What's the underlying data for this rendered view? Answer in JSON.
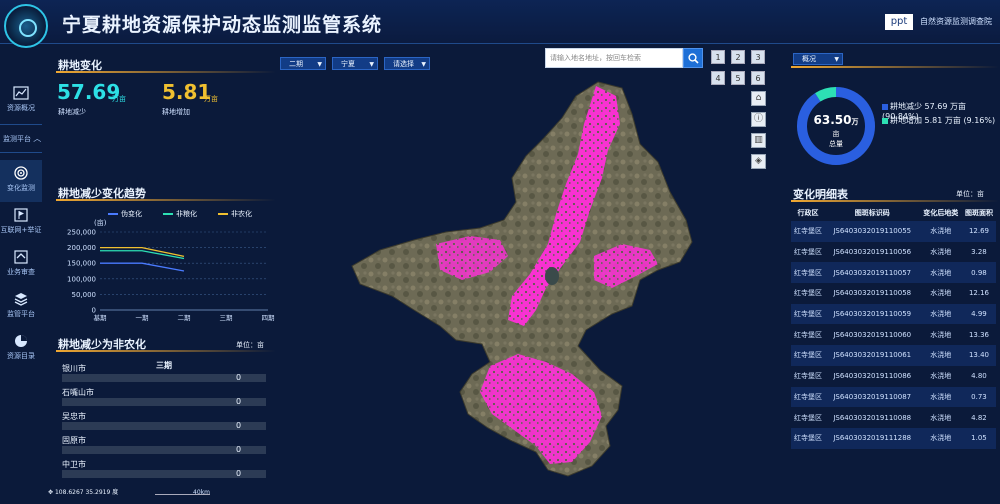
{
  "header": {
    "title": "宁夏耕地资源保护动态监测监管系统",
    "ppt_label": "ppt",
    "org": "自然资源监测调查院"
  },
  "nav": {
    "items": [
      {
        "label": "资源概况",
        "icon": "chart-line-icon"
      },
      {
        "label": "监测平台",
        "icon": "chevron-up-icon"
      },
      {
        "label": "变化监测",
        "icon": "target-icon"
      },
      {
        "label": "互联网+举证",
        "icon": "flag-icon"
      },
      {
        "label": "业务审查",
        "icon": "home-icon"
      },
      {
        "label": "监管平台",
        "icon": "layers-icon"
      },
      {
        "label": "资源目录",
        "icon": "pie-icon"
      }
    ]
  },
  "left": {
    "change_title": "耕地变化",
    "decrease_value": "57.69",
    "decrease_unit": "万亩",
    "decrease_label": "耕地减少",
    "increase_value": "5.81",
    "increase_unit": "万亩",
    "increase_label": "耕地增加",
    "trend_title": "耕地减少变化趋势",
    "bars_title": "耕地减少为非农化",
    "bars_unit": "单位：亩",
    "bars_period": "三期",
    "bars": [
      {
        "name": "银川市",
        "value": "0",
        "fraction": 0
      },
      {
        "name": "石嘴山市",
        "value": "0",
        "fraction": 0
      },
      {
        "name": "吴忠市",
        "value": "0",
        "fraction": 0
      },
      {
        "name": "固原市",
        "value": "0",
        "fraction": 0
      },
      {
        "name": "中卫市",
        "value": "0",
        "fraction": 0
      }
    ]
  },
  "chart_data": {
    "type": "line",
    "ylabel": "(亩)",
    "categories": [
      "基期",
      "一期",
      "二期",
      "三期",
      "四期"
    ],
    "yticks": [
      "0",
      "50,000",
      "100,000",
      "150,000",
      "200,000",
      "250,000"
    ],
    "ylim": [
      0,
      250000
    ],
    "grid": true,
    "legend_position": "top",
    "series": [
      {
        "name": "伪变化",
        "color": "#4a7bff",
        "values": [
          150000,
          150000,
          125000,
          null,
          null
        ]
      },
      {
        "name": "非粮化",
        "color": "#2de0b4",
        "values": [
          190000,
          190000,
          165000,
          null,
          null
        ]
      },
      {
        "name": "非农化",
        "color": "#f0c030",
        "values": [
          200000,
          200000,
          172000,
          null,
          null
        ]
      }
    ]
  },
  "filters": {
    "period": "二期",
    "region": "宁夏",
    "choose": "请选择"
  },
  "search": {
    "placeholder": "请输入地名地址，按回车检索"
  },
  "map_buttons": [
    "1",
    "2",
    "3",
    "4",
    "5",
    "6"
  ],
  "map_tools": [
    {
      "icon": "home-icon",
      "glyph": "⌂"
    },
    {
      "icon": "info-icon",
      "glyph": "ⓘ"
    },
    {
      "icon": "measure-icon",
      "glyph": "▥"
    },
    {
      "icon": "layers-icon",
      "glyph": "◈"
    }
  ],
  "right": {
    "overview_select": "概况",
    "donut_value": "63.50",
    "donut_unit": "万",
    "donut_unit2": "亩",
    "donut_label": "总量",
    "legend": [
      {
        "label": "耕地减少 57.69 万亩 (90.84%)",
        "color": "#2a5fe0",
        "fraction": 0.9084
      },
      {
        "label": "耕地增加 5.81 万亩 (9.16%)",
        "color": "#2de0b4",
        "fraction": 0.0916
      }
    ],
    "table_title": "变化明细表",
    "table_unit": "单位：亩",
    "columns": [
      "行政区",
      "图斑标识码",
      "变化后地类",
      "图斑面积"
    ],
    "rows": [
      [
        "红寺堡区",
        "JS6403032019110055",
        "水浇地",
        "12.69"
      ],
      [
        "红寺堡区",
        "JS6403032019110056",
        "水浇地",
        "3.28"
      ],
      [
        "红寺堡区",
        "JS6403032019110057",
        "水浇地",
        "0.98"
      ],
      [
        "红寺堡区",
        "JS6403032019110058",
        "水浇地",
        "12.16"
      ],
      [
        "红寺堡区",
        "JS6403032019110059",
        "水浇地",
        "4.99"
      ],
      [
        "红寺堡区",
        "JS6403032019110060",
        "水浇地",
        "13.36"
      ],
      [
        "红寺堡区",
        "JS6403032019110061",
        "水浇地",
        "13.40"
      ],
      [
        "红寺堡区",
        "JS6403032019110086",
        "水浇地",
        "4.80"
      ],
      [
        "红寺堡区",
        "JS6403032019110087",
        "水浇地",
        "0.73"
      ],
      [
        "红寺堡区",
        "JS6403032019110088",
        "水浇地",
        "4.82"
      ],
      [
        "红寺堡区",
        "JS6403032019111288",
        "水浇地",
        "1.05"
      ]
    ]
  },
  "status": {
    "coords": "108.6267 35.2919 度",
    "scale": "40km"
  }
}
